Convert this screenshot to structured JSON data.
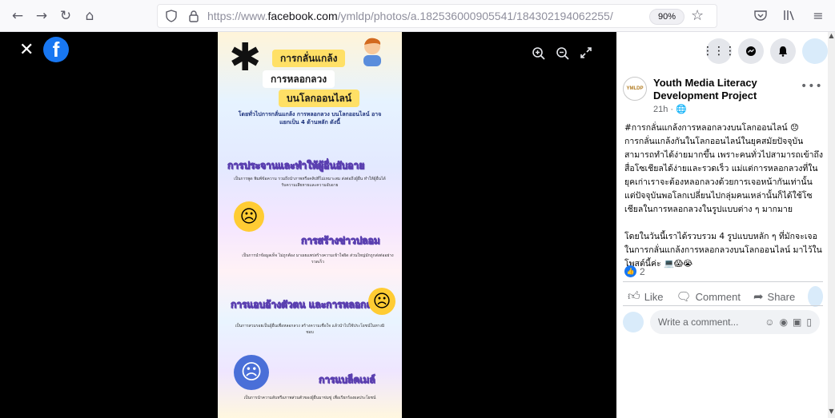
{
  "browser": {
    "url_prefix": "https://www.",
    "url_domain": "facebook.com",
    "url_path": "/ymldp/photos/a.182536000905541/184302194062255/",
    "zoom": "90%"
  },
  "poster": {
    "title_line1": "การกลั่นแกล้ง",
    "title_line2": "การหลอกลวง",
    "title_line3": "บนโลกออนไลน์",
    "intro": "โดยทั่วไปการกลั่นแกล้ง การหลอกลวง บนโลกออนไลน์ อาจแยกเป็น 4 ด้านหลัก ดังนี้",
    "sections": [
      {
        "title": "การประจานและทำให้ผู้อื่นอับอาย",
        "body": "เป็นการพูด พิมพ์ข้อความ รวมถึงนำภาพหรือคลิปที่ไม่เหมาะสม ส่งต่อถึงผู้อื่น ทำให้ผู้อื่นได้รับความเสียหายและความอับอาย"
      },
      {
        "title": "การสร้างข่าวปลอม",
        "body": "เป็นการนำข้อมูลเท็จ ไม่ถูกต้อง มาเผยแพร่สร้างความเข้าใจผิด ส่วนใหญ่มักถูกส่งต่ออย่างรวดเร็ว"
      },
      {
        "title": "การแอบอ้างตัวตน และการหลอกลวง",
        "body": "เป็นการสวมรอยเป็นผู้อื่นเพื่อหลอกลวง สร้างความเชื่อใจ แล้วนำไปใช้ประโยชน์ในทางมิชอบ"
      },
      {
        "title": "การแบล็คเมล์",
        "body": "เป็นการนำความลับหรือภาพส่วนตัวของผู้อื่นมาข่มขู่ เพื่อเรียกร้องผลประโยชน์"
      }
    ]
  },
  "panel": {
    "page_avatar_text": "YMLDP",
    "page_name": "Youth Media Literacy Development Project",
    "post_time": "21h",
    "post_text": "#การกลั่นแกล้งการหลอกลวงบนโลกออนไลน์ 😞\nการกลั่นแกล้งกันในโลกออนไลน์ในยุคสมัยปัจจุบันสามารถทำได้ง่ายมากขึ้น เพราะคนทั่วไปสามารถเข้าถึงสื่อโซเชียลได้ง่ายและรวดเร็ว แม่แต่การหลอกลวงที่ในยุคเก่าเราจะต้องหลอกลวงด้วยการเจอหน้ากันเท่านั้น แต่ปัจจุบันพอโลกเปลี่ยนไปกลุ่มคนเหล่านั้นก็ได้ใช้โซเชียลในการหลอกลวงในรูปแบบต่าง ๆ มากมาย\n\nโดยในวันนี้เราได้รวบรวม 4 รูปแบบหลัก ๆ ที่มักจะเจอในการกลั่นแกล้งการหลอกลวงบนโลกออนไลน์ มาไว้ในโพสต์นี้ค่ะ 💻😱😭",
    "reaction_count": "2",
    "like_label": "Like",
    "comment_label": "Comment",
    "share_label": "Share",
    "comment_placeholder": "Write a comment..."
  }
}
